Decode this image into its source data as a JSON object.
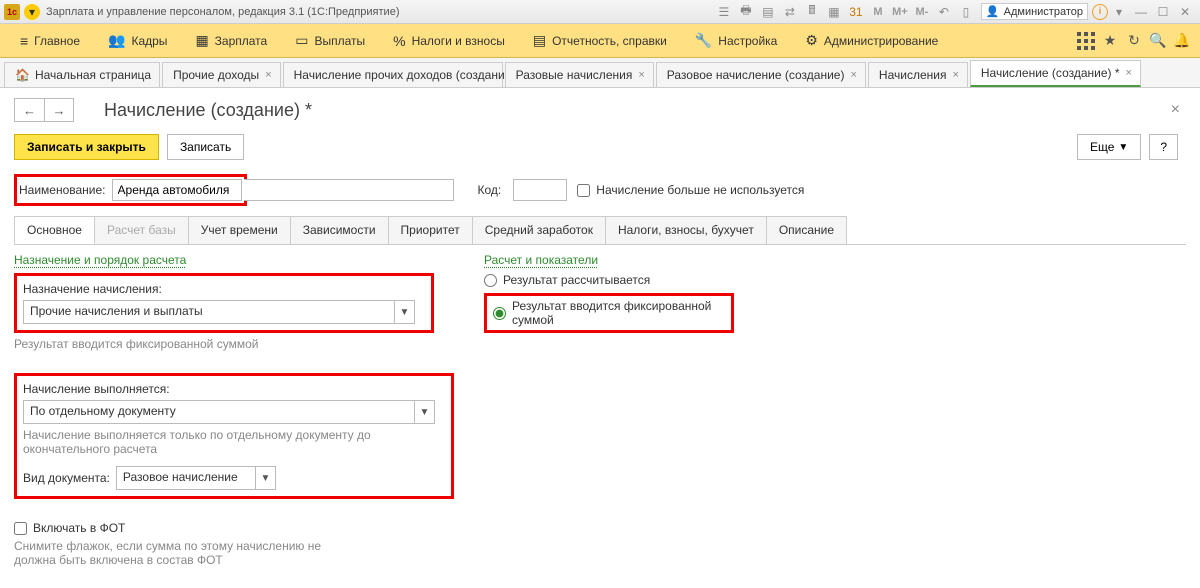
{
  "titlebar": {
    "app_title": "Зарплата и управление персоналом, редакция 3.1  (1С:Предприятие)",
    "user": "Администратор",
    "m_labels": [
      "M",
      "M+",
      "M-"
    ]
  },
  "mainmenu": {
    "items": [
      {
        "label": "Главное"
      },
      {
        "label": "Кадры"
      },
      {
        "label": "Зарплата"
      },
      {
        "label": "Выплаты"
      },
      {
        "label": "Налоги и взносы"
      },
      {
        "label": "Отчетность, справки"
      },
      {
        "label": "Настройка"
      },
      {
        "label": "Администрирование"
      }
    ]
  },
  "tabs": [
    {
      "label": "Начальная страница",
      "home": true
    },
    {
      "label": "Прочие доходы"
    },
    {
      "label": "Начисление прочих доходов (создание) *"
    },
    {
      "label": "Разовые начисления"
    },
    {
      "label": "Разовое начисление (создание)"
    },
    {
      "label": "Начисления"
    },
    {
      "label": "Начисление (создание) *",
      "active": true
    }
  ],
  "header": {
    "title": "Начисление (создание) *"
  },
  "toolbar": {
    "save_close": "Записать и закрыть",
    "save": "Записать",
    "more": "Еще",
    "help": "?"
  },
  "form": {
    "name_label": "Наименование:",
    "name_value": "Аренда автомобиля",
    "code_label": "Код:",
    "code_value": "",
    "not_used_label": "Начисление больше не используется"
  },
  "inner_tabs": [
    "Основное",
    "Расчет базы",
    "Учет времени",
    "Зависимости",
    "Приоритет",
    "Средний заработок",
    "Налоги, взносы, бухучет",
    "Описание"
  ],
  "left": {
    "section": "Назначение и порядок расчета",
    "assign_label": "Назначение начисления:",
    "assign_value": "Прочие начисления и выплаты",
    "assign_note": "Результат вводится фиксированной суммой",
    "exec_label": "Начисление выполняется:",
    "exec_value": "По отдельному документу",
    "exec_note": "Начисление выполняется только по отдельному документу до окончательного расчета",
    "doctype_label": "Вид документа:",
    "doctype_value": "Разовое начисление",
    "fot_label": "Включать в ФОТ",
    "fot_note": "Снимите флажок, если сумма по этому начислению не должна быть включена в состав ФОТ"
  },
  "right": {
    "section": "Расчет и показатели",
    "r1": "Результат рассчитывается",
    "r2": "Результат вводится фиксированной суммой"
  }
}
